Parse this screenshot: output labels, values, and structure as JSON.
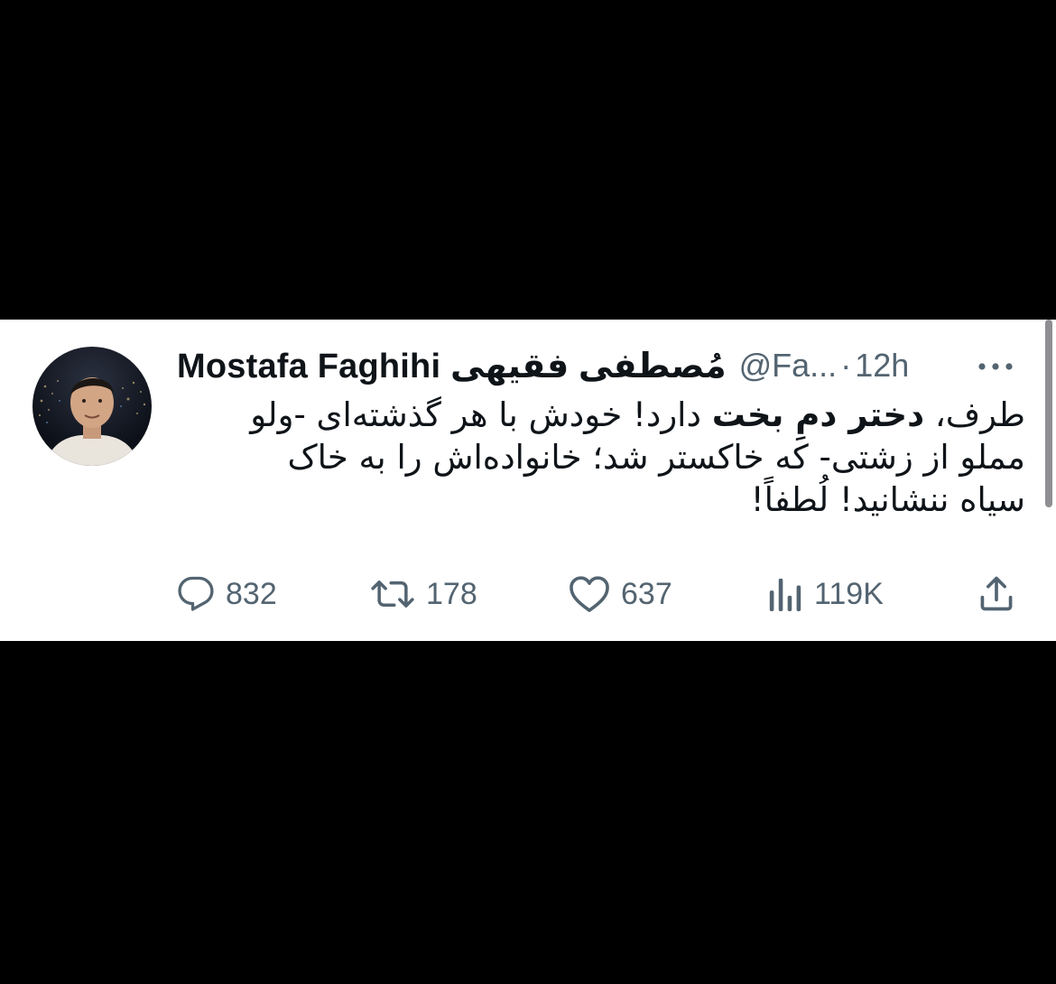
{
  "tweet": {
    "author": {
      "display_name": "Mostafa Faghihi مُصطفی فقیهی",
      "handle": "@Fa...",
      "separator": "·",
      "time": "12h"
    },
    "body": {
      "line1_a": "طرف، ",
      "line1_bold": "دختر دمِ بخت",
      "line1_b": " دارد! خودش با هر گذشته‌ای -ولو",
      "line2": "مملو از زشتی- که خاکستر شد؛ خانواده‌اش را به خاک",
      "line3": "سیاه ننشانید! لُطفاً!"
    },
    "actions": {
      "replies": "832",
      "retweets": "178",
      "likes": "637",
      "views": "119K"
    },
    "icons": {
      "more": "more-horizontal-icon",
      "reply": "reply-bubble-icon",
      "retweet": "retweet-icon",
      "like": "heart-icon",
      "views": "views-bars-icon",
      "share": "share-upload-icon"
    }
  },
  "colors": {
    "background": "#000000",
    "card": "#ffffff",
    "text_primary": "#0f1419",
    "text_secondary": "#536471"
  }
}
